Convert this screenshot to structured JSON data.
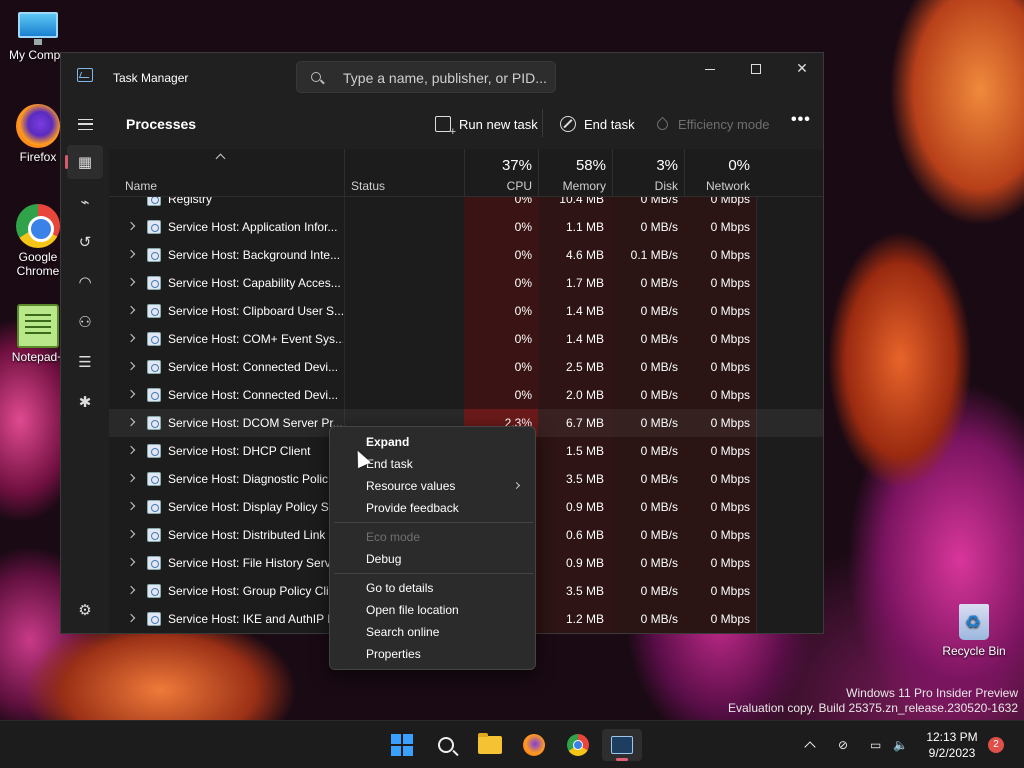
{
  "desktop": {
    "icons": [
      {
        "label": "My Compu",
        "icon": "monitor-icon"
      },
      {
        "label": "Firefox",
        "icon": "firefox-icon"
      },
      {
        "label": "Google Chrome",
        "icon": "chrome-icon"
      },
      {
        "label": "Notepad+",
        "icon": "notepad-plus-icon"
      },
      {
        "label": "Recycle Bin",
        "icon": "recycle-bin-icon"
      }
    ],
    "watermark": {
      "line1": "Windows 11 Pro Insider Preview",
      "line2": "Evaluation copy. Build 25375.zn_release.230520-1632"
    }
  },
  "window": {
    "title": "Task Manager",
    "search_placeholder": "Type a name, publisher, or PID..."
  },
  "rail": {
    "items": [
      "hamburger-icon",
      "processes-icon",
      "performance-icon",
      "app-history-icon",
      "startup-apps-icon",
      "users-icon",
      "details-icon",
      "services-icon",
      "settings-icon"
    ],
    "active": "processes-icon"
  },
  "commandbar": {
    "title": "Processes",
    "run_new_task": "Run new task",
    "end_task": "End task",
    "efficiency_mode": "Efficiency mode",
    "more": "•••"
  },
  "table": {
    "columns": {
      "name": "Name",
      "status": "Status",
      "cpu": {
        "label": "CPU",
        "total": "37%"
      },
      "memory": {
        "label": "Memory",
        "total": "58%"
      },
      "disk": {
        "label": "Disk",
        "total": "3%"
      },
      "network": {
        "label": "Network",
        "total": "0%"
      }
    },
    "rows": [
      {
        "name": "Registry",
        "cpu": "0%",
        "memory": "10.4 MB",
        "disk": "0 MB/s",
        "network": "0 Mbps"
      },
      {
        "name": "Service Host: Application Infor...",
        "cpu": "0%",
        "memory": "1.1 MB",
        "disk": "0 MB/s",
        "network": "0 Mbps"
      },
      {
        "name": "Service Host: Background Inte...",
        "cpu": "0%",
        "memory": "4.6 MB",
        "disk": "0.1 MB/s",
        "network": "0 Mbps"
      },
      {
        "name": "Service Host: Capability Acces...",
        "cpu": "0%",
        "memory": "1.7 MB",
        "disk": "0 MB/s",
        "network": "0 Mbps"
      },
      {
        "name": "Service Host: Clipboard User S...",
        "cpu": "0%",
        "memory": "1.4 MB",
        "disk": "0 MB/s",
        "network": "0 Mbps"
      },
      {
        "name": "Service Host: COM+ Event Sys...",
        "cpu": "0%",
        "memory": "1.4 MB",
        "disk": "0 MB/s",
        "network": "0 Mbps"
      },
      {
        "name": "Service Host: Connected Devi...",
        "cpu": "0%",
        "memory": "2.5 MB",
        "disk": "0 MB/s",
        "network": "0 Mbps"
      },
      {
        "name": "Service Host: Connected Devi...",
        "cpu": "0%",
        "memory": "2.0 MB",
        "disk": "0 MB/s",
        "network": "0 Mbps"
      },
      {
        "name": "Service Host: DCOM Server Pr...",
        "cpu": "2.3%",
        "memory": "6.7 MB",
        "disk": "0 MB/s",
        "network": "0 Mbps"
      },
      {
        "name": "Service Host: DHCP Client",
        "cpu": "",
        "memory": "1.5 MB",
        "disk": "0 MB/s",
        "network": "0 Mbps"
      },
      {
        "name": "Service Host: Diagnostic Polic...",
        "cpu": "",
        "memory": "3.5 MB",
        "disk": "0 MB/s",
        "network": "0 Mbps"
      },
      {
        "name": "Service Host: Display Policy Se...",
        "cpu": "",
        "memory": "0.9 MB",
        "disk": "0 MB/s",
        "network": "0 Mbps"
      },
      {
        "name": "Service Host: Distributed Link ...",
        "cpu": "",
        "memory": "0.6 MB",
        "disk": "0 MB/s",
        "network": "0 Mbps"
      },
      {
        "name": "Service Host: File History Servi...",
        "cpu": "",
        "memory": "0.9 MB",
        "disk": "0 MB/s",
        "network": "0 Mbps"
      },
      {
        "name": "Service Host: Group Policy Cli...",
        "cpu": "",
        "memory": "3.5 MB",
        "disk": "0 MB/s",
        "network": "0 Mbps"
      },
      {
        "name": "Service Host: IKE and AuthIP I...",
        "cpu": "",
        "memory": "1.2 MB",
        "disk": "0 MB/s",
        "network": "0 Mbps"
      }
    ]
  },
  "context_menu": {
    "expand": "Expand",
    "end_task": "End task",
    "resource_values": "Resource values",
    "provide_feedback": "Provide feedback",
    "eco_mode": "Eco mode",
    "debug": "Debug",
    "go_to_details": "Go to details",
    "open_file_location": "Open file location",
    "search_online": "Search online",
    "properties": "Properties"
  },
  "taskbar": {
    "apps": [
      "start-icon",
      "search-icon",
      "file-explorer-icon",
      "firefox-icon",
      "chrome-icon",
      "task-manager-icon"
    ],
    "active_app": "task-manager-icon",
    "time": "12:13 PM",
    "date": "9/2/2023",
    "notifications": "2"
  },
  "colors": {
    "accent": "#e0607a",
    "window_bg": "#202020",
    "cpu_heat": "#3a1414"
  }
}
